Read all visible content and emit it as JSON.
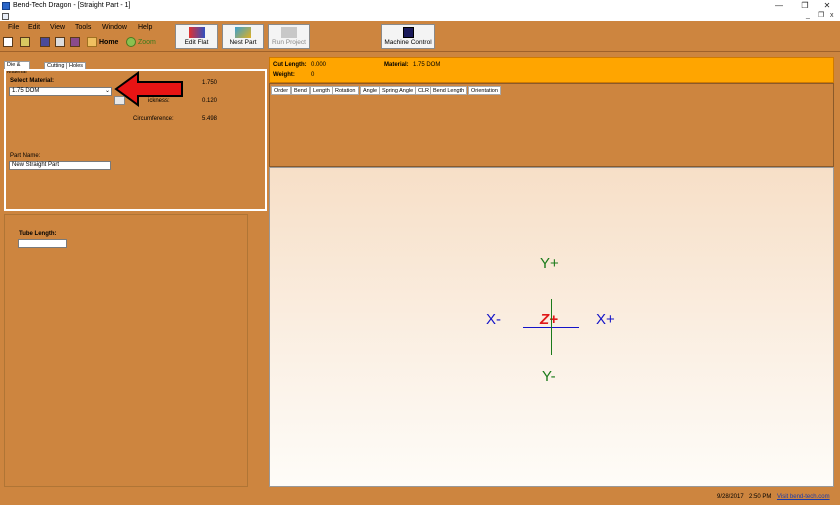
{
  "window": {
    "title": "Bend-Tech Dragon - [Straight Part - 1]",
    "minimize": "—",
    "maximize": "❐",
    "close": "✕",
    "mdi_minimize": "_",
    "mdi_restore": "❐",
    "mdi_close": "x"
  },
  "menu": [
    "File",
    "Edit",
    "View",
    "Tools",
    "Window",
    "Help"
  ],
  "toolbar": {
    "home_label": "Home",
    "zoom_label": "Zoom"
  },
  "big_buttons": {
    "edit_flat": "Edit Flat",
    "nest_part": "Nest Part",
    "run_project": "Run Project",
    "machine_control": "Machine Control"
  },
  "left_tabs": [
    "Die & Material",
    "Cutting",
    "Holes"
  ],
  "material": {
    "select_label": "Select Material:",
    "selected": "1.75 DOM",
    "diameter_value": "1.750",
    "thickness_label_partial": "ickness:",
    "thickness_value": "0.120",
    "circumference_label": "Circumference:",
    "circumference_value": "5.498"
  },
  "part": {
    "name_label": "Part Name:",
    "name_value": "New Straight Part"
  },
  "tube": {
    "length_label": "Tube Length:",
    "length_value": ""
  },
  "summary": {
    "cut_length_label": "Cut Length:",
    "cut_length_value": "0.000",
    "weight_label": "Weight:",
    "weight_value": "0",
    "material_label": "Material:",
    "material_value": "1.75 DOM"
  },
  "grid_columns": [
    "Order",
    "Bend",
    "Length",
    "Rotation",
    "Angle",
    "Spring Angle",
    "CLR",
    "Bend Length",
    "Orientation"
  ],
  "viewport": {
    "y_plus": "Y+",
    "y_minus": "Y-",
    "x_minus": "X-",
    "x_plus": "X+",
    "z_plus": "Z+"
  },
  "status": {
    "date": "9/28/2017",
    "time": "2:50 PM",
    "link": "Visit bend-tech.com"
  },
  "colors": {
    "background": "#cd853f",
    "info_panel": "#ffa500",
    "y_axis": "#1a7a1a",
    "x_axis": "#1414c8",
    "z_axis": "#e01818",
    "highlight_arrow": "#e81414"
  }
}
